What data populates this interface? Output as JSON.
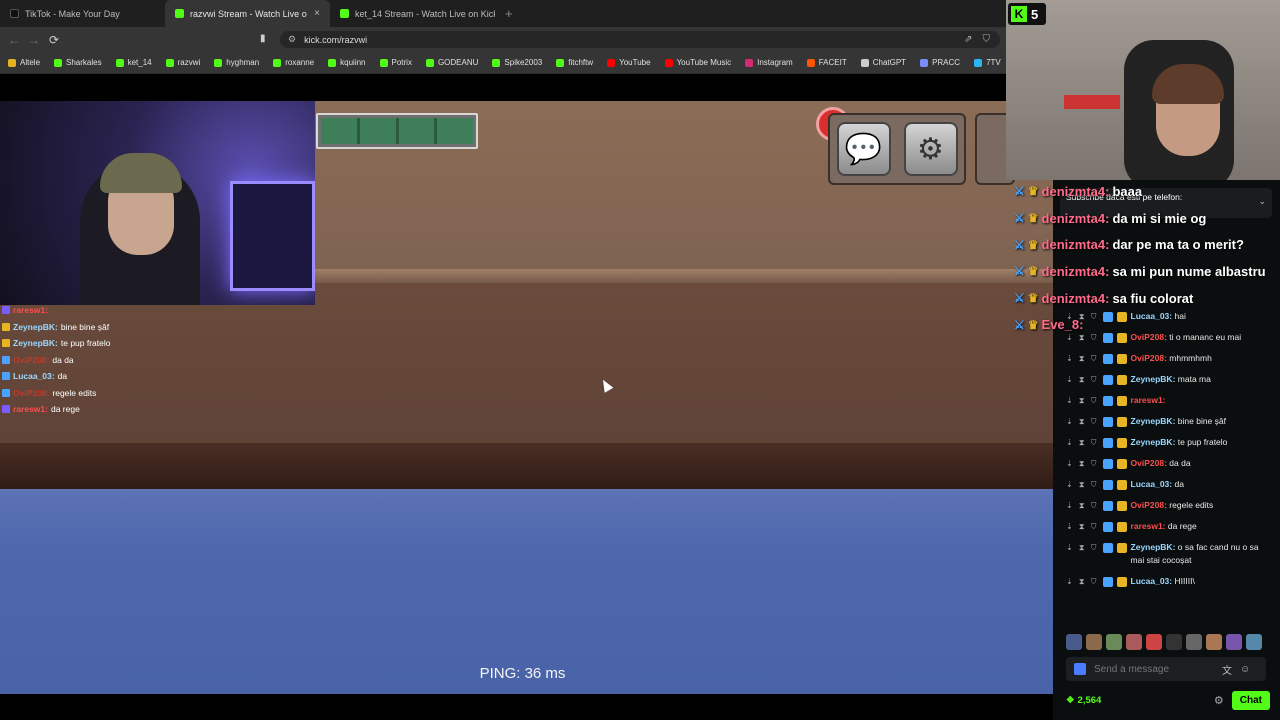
{
  "tabs": [
    {
      "label": "TikTok - Make Your Day",
      "color": "#111111",
      "active": false
    },
    {
      "label": "razvwi Stream - Watch Live o",
      "color": "#53fc18",
      "active": true
    },
    {
      "label": "ket_14 Stream - Watch Live on Kick",
      "color": "#53fc18",
      "active": false
    }
  ],
  "tab_new": "+",
  "tab_close": "×",
  "nav": {
    "back": "←",
    "forward": "→",
    "reload": "⟳",
    "url": "kick.com/razvwi"
  },
  "bookmarks": [
    {
      "label": "Altele",
      "color": "#e6b422"
    },
    {
      "label": "Sharkales",
      "color": "#53fc18"
    },
    {
      "label": "ket_14",
      "color": "#53fc18"
    },
    {
      "label": "razvwi",
      "color": "#53fc18"
    },
    {
      "label": "hyghman",
      "color": "#53fc18"
    },
    {
      "label": "roxanne",
      "color": "#53fc18"
    },
    {
      "label": "kquiinn",
      "color": "#53fc18"
    },
    {
      "label": "Potrix",
      "color": "#53fc18"
    },
    {
      "label": "GODEANU",
      "color": "#53fc18"
    },
    {
      "label": "Spike2003",
      "color": "#53fc18"
    },
    {
      "label": "fitchftw",
      "color": "#53fc18"
    },
    {
      "label": "YouTube",
      "color": "#ff0000"
    },
    {
      "label": "YouTube Music",
      "color": "#ff0000"
    },
    {
      "label": "Instagram",
      "color": "#d62976"
    },
    {
      "label": "FACEIT",
      "color": "#ff5500"
    },
    {
      "label": "ChatGPT",
      "color": "#cccccc"
    },
    {
      "label": "PRACC",
      "color": "#7a8cff"
    },
    {
      "label": "7TV",
      "color": "#29b6f6"
    }
  ],
  "game": {
    "ping": "PING: 36 ms",
    "task_progress": 0,
    "hud_chat_icon": "💬",
    "hud_settings_icon": "⚙"
  },
  "kick_badge": {
    "letter": "K",
    "count": "5"
  },
  "left_chat": [
    {
      "user": "raresw1:",
      "text": "",
      "user_color": "#ff4d4d",
      "badge": "#7a5cff"
    },
    {
      "user": "ZeynepBK:",
      "text": "bine bine șâf",
      "user_color": "#9ad8ff",
      "badge": "#e7b423"
    },
    {
      "user": "ZeynepBK:",
      "text": "te pup fratelo",
      "user_color": "#9ad8ff",
      "badge": "#e7b423"
    },
    {
      "user": "OviP208:",
      "text": "da da",
      "user_color": "#c0392b",
      "badge": "#4aa3ff"
    },
    {
      "user": "Lucaa_03:",
      "text": "da",
      "user_color": "#9ad8ff",
      "badge": "#4aa3ff"
    },
    {
      "user": "OviP208:",
      "text": "regele edits",
      "user_color": "#c0392b",
      "badge": "#4aa3ff"
    },
    {
      "user": "raresw1:",
      "text": "da rege",
      "user_color": "#ff4d4d",
      "badge": "#7a5cff"
    }
  ],
  "big_chat": [
    {
      "user": "denizmta4:",
      "text": "baaa"
    },
    {
      "user": "denizmta4:",
      "text": "da mi si mie og"
    },
    {
      "user": "denizmta4:",
      "text": "dar pe ma ta o merit?"
    },
    {
      "user": "denizmta4:",
      "text": "sa mi pun nume albastru"
    },
    {
      "user": "denizmta4:",
      "text": "sa fiu colorat"
    },
    {
      "user": "Eve_8:",
      "text": ""
    }
  ],
  "pinned": {
    "text": "Subscribe daca esti pe telefon:",
    "chevron": "⌄"
  },
  "kick_chat": [
    {
      "user": "Lucaa_03:",
      "text": "hai",
      "user_color": "#9ad8ff"
    },
    {
      "user": "OviP208:",
      "text": "ti o mananc eu mai",
      "user_color": "#ff4d4d"
    },
    {
      "user": "OviP208:",
      "text": "mhmmhmh",
      "user_color": "#ff4d4d"
    },
    {
      "user": "ZeynepBK:",
      "text": "mata ma",
      "user_color": "#9ad8ff"
    },
    {
      "user": "raresw1:",
      "text": "",
      "user_color": "#ff4d4d"
    },
    {
      "user": "ZeynepBK:",
      "text": "bine bine șâf",
      "user_color": "#9ad8ff"
    },
    {
      "user": "ZeynepBK:",
      "text": "te pup fratelo",
      "user_color": "#9ad8ff"
    },
    {
      "user": "OviP208:",
      "text": "da da",
      "user_color": "#ff4d4d"
    },
    {
      "user": "Lucaa_03:",
      "text": "da",
      "user_color": "#9ad8ff"
    },
    {
      "user": "OviP208:",
      "text": "regele edits",
      "user_color": "#ff4d4d"
    },
    {
      "user": "raresw1:",
      "text": "da rege",
      "user_color": "#ff4d4d"
    },
    {
      "user": "ZeynepBK:",
      "text": "o sa fac cand nu o sa mai stai cocoșat",
      "user_color": "#9ad8ff"
    },
    {
      "user": "Lucaa_03:",
      "text": "HIIIII\\",
      "user_color": "#9ad8ff"
    }
  ],
  "message_tools": "⇣ ⧗ ⛉",
  "send_placeholder": "Send a message",
  "viewer_points": "2,564",
  "chat_button": "Chat",
  "colors": {
    "kick_green": "#53fc18",
    "panel_bg": "#0b0e0f"
  }
}
